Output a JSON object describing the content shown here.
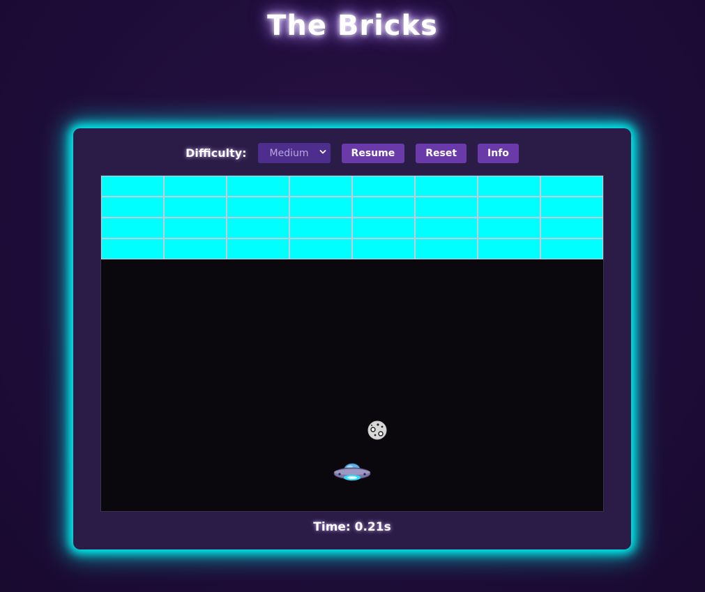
{
  "title": "The Bricks",
  "controls": {
    "difficulty_label": "Difficulty:",
    "difficulty_value": "Medium",
    "resume_label": "Resume",
    "reset_label": "Reset",
    "info_label": "Info"
  },
  "game": {
    "brick_rows": 4,
    "brick_cols": 8,
    "brick_color": "#00ffff",
    "ball_icon": "moon-ball-icon",
    "paddle_icon": "ufo-paddle-icon"
  },
  "status": {
    "time_text": "Time: 0.21s"
  },
  "colors": {
    "background": "#1f0d3a",
    "panel": "#2b1b47",
    "glow": "#00f0f0",
    "button": "#6a3aa8",
    "select": "#4e2e8c"
  }
}
